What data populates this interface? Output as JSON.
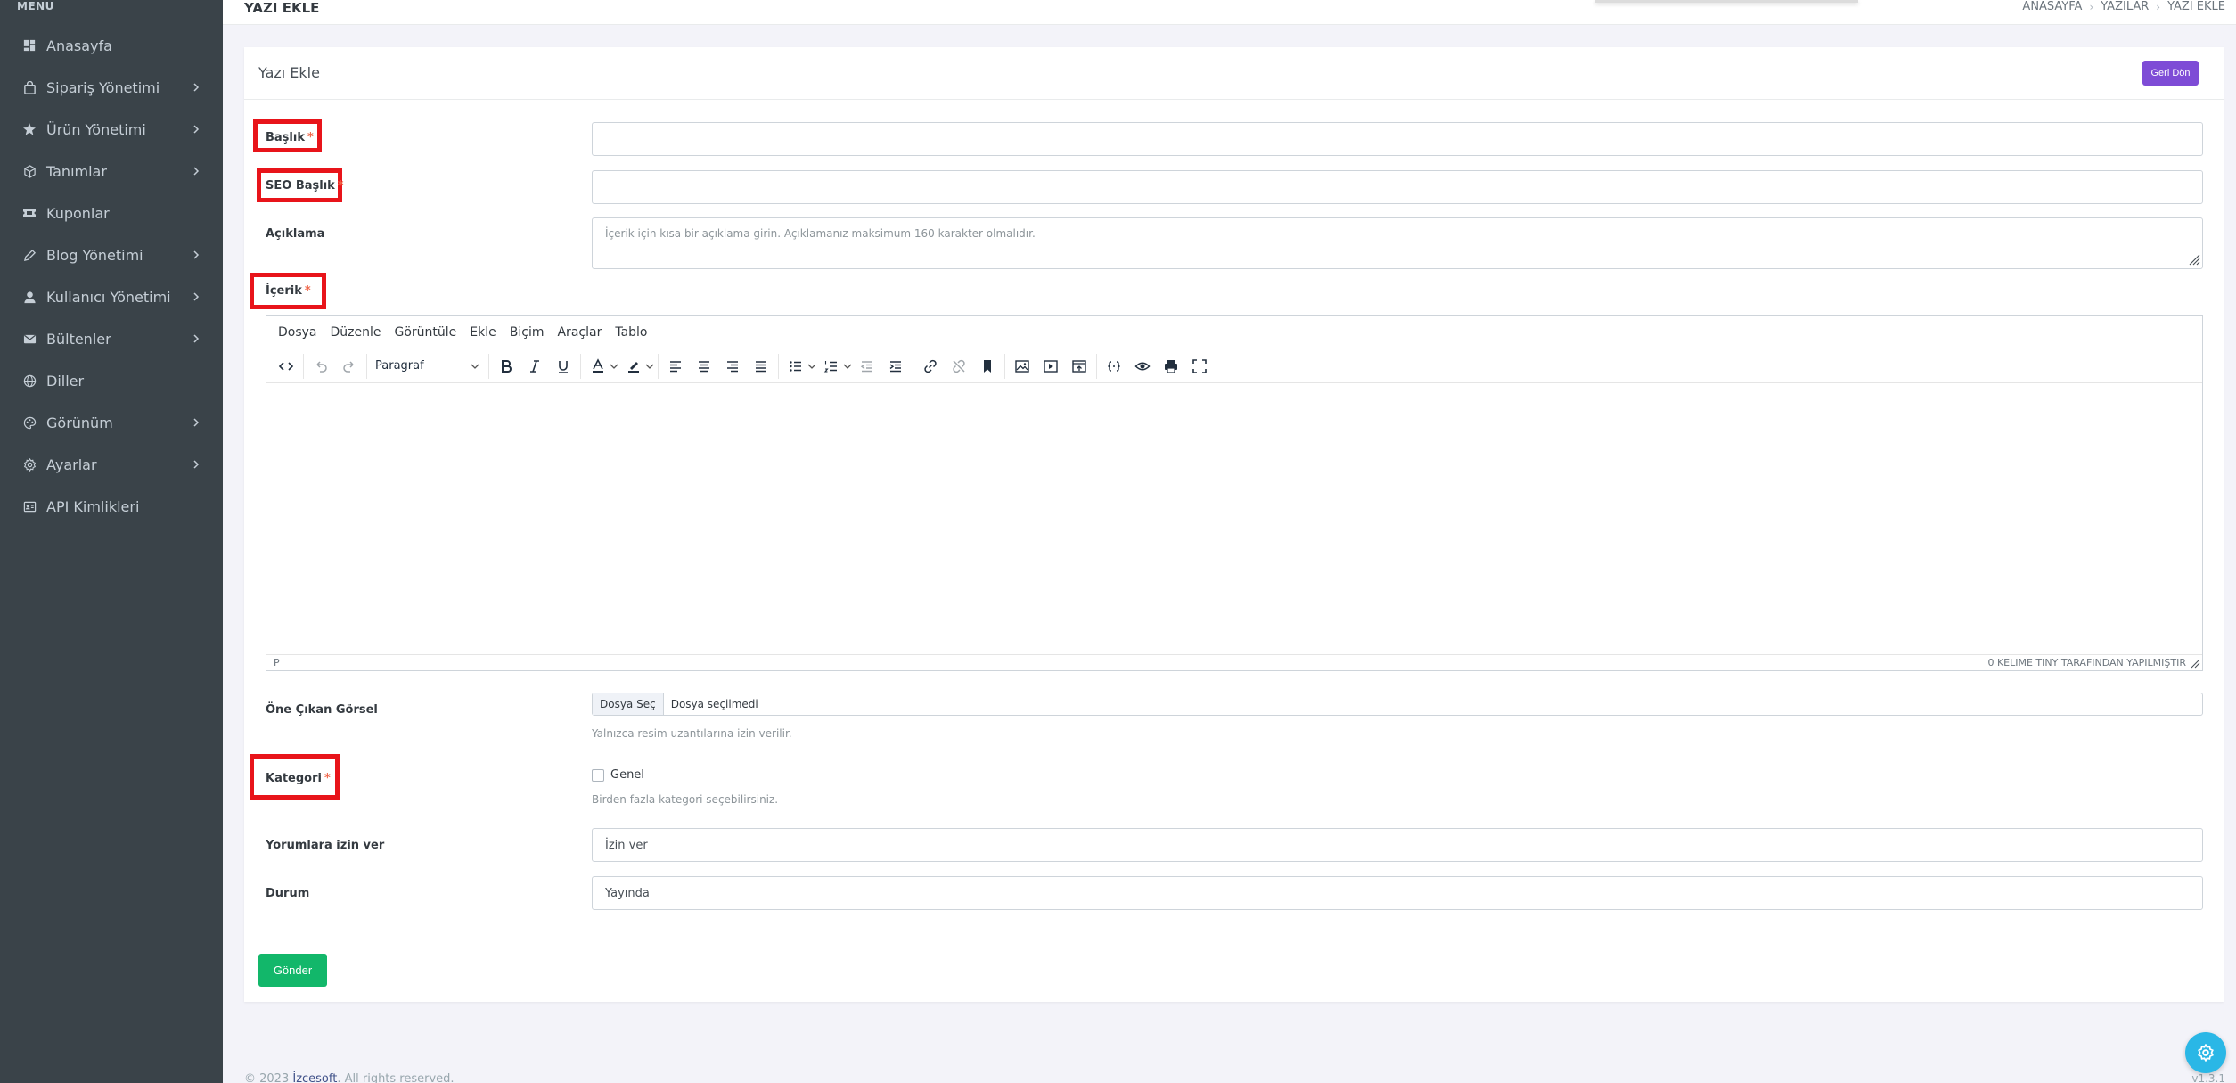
{
  "sidebar": {
    "menu_title": "MENU",
    "items": [
      {
        "label": "Anasayfa",
        "icon": "dashboard-icon",
        "has_children": false
      },
      {
        "label": "Sipariş Yönetimi",
        "icon": "bag-icon",
        "has_children": true
      },
      {
        "label": "Ürün Yönetimi",
        "icon": "star-icon",
        "has_children": true
      },
      {
        "label": "Tanımlar",
        "icon": "cube-icon",
        "has_children": true
      },
      {
        "label": "Kuponlar",
        "icon": "ticket-icon",
        "has_children": false
      },
      {
        "label": "Blog Yönetimi",
        "icon": "pen-icon",
        "has_children": true
      },
      {
        "label": "Kullanıcı Yönetimi",
        "icon": "user-icon",
        "has_children": true
      },
      {
        "label": "Bültenler",
        "icon": "mail-icon",
        "has_children": true
      },
      {
        "label": "Diller",
        "icon": "globe-icon",
        "has_children": false
      },
      {
        "label": "Görünüm",
        "icon": "palette-icon",
        "has_children": true
      },
      {
        "label": "Ayarlar",
        "icon": "gear-icon",
        "has_children": true
      },
      {
        "label": "API Kimlikleri",
        "icon": "id-card-icon",
        "has_children": false
      }
    ]
  },
  "header": {
    "page_title": "YAZI EKLE",
    "breadcrumb": [
      "ANASAYFA",
      "YAZILAR",
      "YAZI EKLE"
    ]
  },
  "card": {
    "title": "Yazı Ekle",
    "back_button": "Geri Dön"
  },
  "form": {
    "required_mark": "*",
    "title_label": "Başlık",
    "title_value": "",
    "seo_title_label": "SEO Başlık",
    "seo_title_value": "",
    "description_label": "Açıklama",
    "description_placeholder": "İçerik için kısa bir açıklama girin. Açıklamanız maksimum 160 karakter olmalıdır.",
    "content_label": "İçerik",
    "featured_image_label": "Öne Çıkan Görsel",
    "file_button": "Dosya Seç",
    "file_status": "Dosya seçilmedi",
    "file_help": "Yalnızca resim uzantılarına izin verilir.",
    "category_label": "Kategori",
    "category_option": "Genel",
    "category_help": "Birden fazla kategori seçebilirsiniz.",
    "comments_label": "Yorumlara izin ver",
    "comments_value": "İzin ver",
    "status_label": "Durum",
    "status_value": "Yayında",
    "submit": "Gönder"
  },
  "editor": {
    "menus": [
      "Dosya",
      "Düzenle",
      "Görüntüle",
      "Ekle",
      "Biçim",
      "Araçlar",
      "Tablo"
    ],
    "block_format": "Paragraf",
    "status_path": "P",
    "status_right": "0 KELIME  TINY TARAFINDAN YAPILMIŞTIR"
  },
  "footer": {
    "copyright_prefix": "© 2023",
    "company": "İzcesoft",
    "copyright_suffix": ". All rights reserved.",
    "version": "v1.3.1"
  },
  "colors": {
    "sidebar_bg": "#3a4349",
    "accent_purple": "#7e4cd6",
    "submit_green": "#12b76a",
    "highlight_red": "#e8141a",
    "required_red": "#f06548",
    "fab_blue": "#2ab7e6"
  }
}
